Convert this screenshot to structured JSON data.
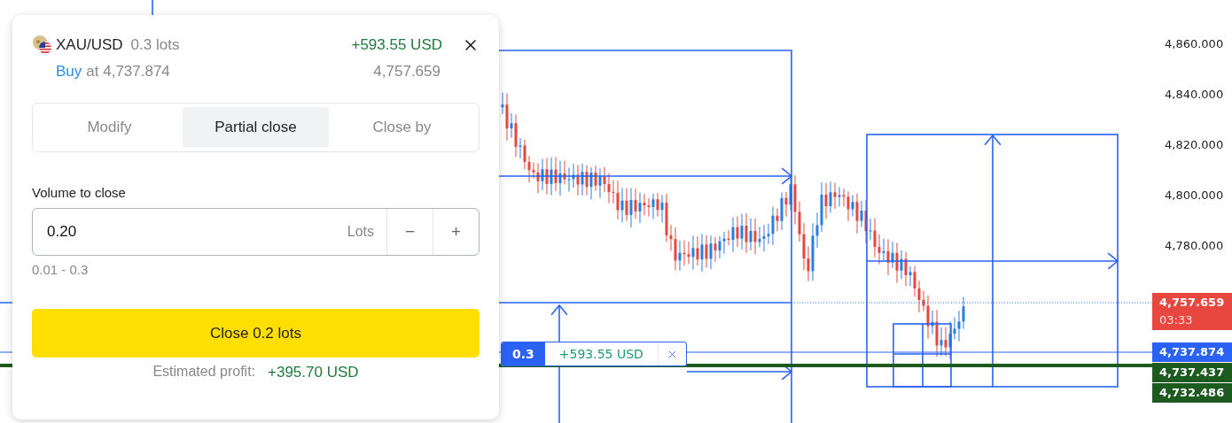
{
  "order_panel": {
    "symbol": "XAU/USD",
    "volume": "0.3 lots",
    "profit": "+593.55 USD",
    "side": "Buy",
    "entry": "at 4,737.874",
    "current_price": "4,757.659",
    "tabs": [
      {
        "label": "Modify",
        "selected": false
      },
      {
        "label": "Partial close",
        "selected": true
      },
      {
        "label": "Close by",
        "selected": false
      }
    ],
    "volume_label": "Volume to close",
    "volume_value": "0.20",
    "unit": "Lots",
    "decrement": "−",
    "increment": "+",
    "range": "0.01 - 0.3",
    "close_button": "Close 0.2 lots",
    "estimate_label": "Estimated profit:",
    "estimate_value": "+395.70 USD"
  },
  "position_chip": {
    "volume": "0.3",
    "profit": "+593.55 USD"
  },
  "price_axis": {
    "labels": [
      "4,860.000",
      "4,840.000",
      "4,820.000",
      "4,800.000",
      "4,780.000"
    ],
    "tags": [
      {
        "price": "4,757.659",
        "timer": "03:33",
        "color": "#e8473f"
      },
      {
        "price": "4,737.874",
        "color": "#2a62f5"
      },
      {
        "price": "4,737.437",
        "color": "#1d5a1f"
      },
      {
        "price": "4,732.486",
        "color": "#1d5a1f"
      }
    ]
  }
}
